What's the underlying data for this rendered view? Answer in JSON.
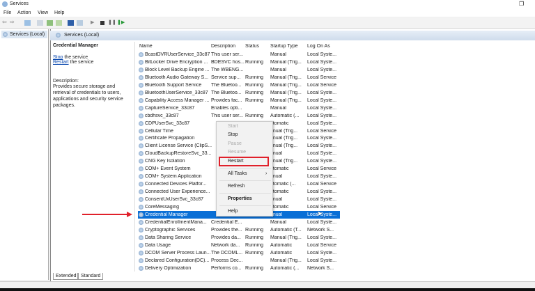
{
  "window": {
    "title": "Services"
  },
  "menubar": [
    "File",
    "Action",
    "View",
    "Help"
  ],
  "tree": {
    "item": "Services (Local)"
  },
  "panel": {
    "header": "Services (Local)",
    "selected_title": "Credential Manager",
    "stop_link": "Stop",
    "stop_rest": " the service",
    "restart_link": "Restart",
    "restart_rest": " the service",
    "description_label": "Description:",
    "description": "Provides secure storage and retrieval of credentials to users, applications and security service packages."
  },
  "columns": [
    "Name",
    "Description",
    "Status",
    "Startup Type",
    "Log On As"
  ],
  "rows": [
    [
      "BcastDVRUserService_33c87",
      "This user ser...",
      "",
      "Manual",
      "Local Syste..."
    ],
    [
      "BitLocker Drive Encryption ...",
      "BDESVC hos...",
      "Running",
      "Manual (Trig...",
      "Local Syste..."
    ],
    [
      "Block Level Backup Engine ...",
      "The WBENG...",
      "",
      "Manual",
      "Local Syste..."
    ],
    [
      "Bluetooth Audio Gateway S...",
      "Service sup...",
      "Running",
      "Manual (Trig...",
      "Local Service"
    ],
    [
      "Bluetooth Support Service",
      "The Bluetoo...",
      "Running",
      "Manual (Trig...",
      "Local Service"
    ],
    [
      "BluetoothUserService_33c87",
      "The Bluetoo...",
      "Running",
      "Manual (Trig...",
      "Local Syste..."
    ],
    [
      "Capability Access Manager ...",
      "Provides fac...",
      "Running",
      "Manual (Trig...",
      "Local Syste..."
    ],
    [
      "CaptureService_33c87",
      "Enables opti...",
      "",
      "Manual",
      "Local Syste..."
    ],
    [
      "cbdhsvc_33c87",
      "This user ser...",
      "Running",
      "Automatic (...",
      "Local Syste..."
    ],
    [
      "CDPUserSvc_33c87",
      "",
      "",
      "utomatic",
      "Local Syste..."
    ],
    [
      "Cellular Time",
      "",
      "",
      "anual (Trig...",
      "Local Service"
    ],
    [
      "Certificate Propagation",
      "",
      "",
      "anual (Trig...",
      "Local Syste..."
    ],
    [
      "Client License Service (ClipS...",
      "",
      "",
      "anual (Trig...",
      "Local Syste..."
    ],
    [
      "CloudBackupRestoreSvc_33...",
      "",
      "",
      "anual",
      "Local Syste..."
    ],
    [
      "CNG Key Isolation",
      "",
      "",
      "anual (Trig...",
      "Local Syste..."
    ],
    [
      "COM+ Event System",
      "",
      "",
      "utomatic",
      "Local Service"
    ],
    [
      "COM+ System Application",
      "",
      "",
      "anual",
      "Local Syste..."
    ],
    [
      "Connected Devices Platfor...",
      "",
      "",
      "utomatic (...",
      "Local Service"
    ],
    [
      "Connected User Experience...",
      "",
      "",
      "utomatic",
      "Local Syste..."
    ],
    [
      "ConsentUxUserSvc_33c87",
      "",
      "",
      "anual",
      "Local Syste..."
    ],
    [
      "CoreMessaging",
      "",
      "",
      "utomatic",
      "Local Service"
    ],
    [
      "Credential Manager",
      "",
      "",
      "anual",
      "Local Syste..."
    ],
    [
      "CredentialEnrollmentMana...",
      "Credential E...",
      "",
      "Manual",
      "Local Syste..."
    ],
    [
      "Cryptographic Services",
      "Provides the...",
      "Running",
      "Automatic (T...",
      "Network S..."
    ],
    [
      "Data Sharing Service",
      "Provides da...",
      "Running",
      "Manual (Trig...",
      "Local Syste..."
    ],
    [
      "Data Usage",
      "Network da...",
      "Running",
      "Automatic",
      "Local Service"
    ],
    [
      "DCOM Server Process Laun...",
      "The DCOML...",
      "Running",
      "Automatic",
      "Local Syste..."
    ],
    [
      "Declared Configuration(DC)...",
      "Process Dec...",
      "",
      "Manual (Trig...",
      "Local Syste..."
    ],
    [
      "Delivery Optimization",
      "Performs co...",
      "Running",
      "Automatic (...",
      "Network S..."
    ]
  ],
  "selected_row": 21,
  "context_menu": {
    "start": "Start",
    "stop": "Stop",
    "pause": "Pause",
    "resume": "Resume",
    "restart": "Restart",
    "all_tasks": "All Tasks",
    "refresh": "Refresh",
    "properties": "Properties",
    "help": "Help"
  },
  "tabs": [
    "Extended",
    "Standard"
  ],
  "colors": {
    "selection": "#0a6fd6",
    "highlight_box": "#e0202a",
    "arrow": "#e0202a"
  }
}
